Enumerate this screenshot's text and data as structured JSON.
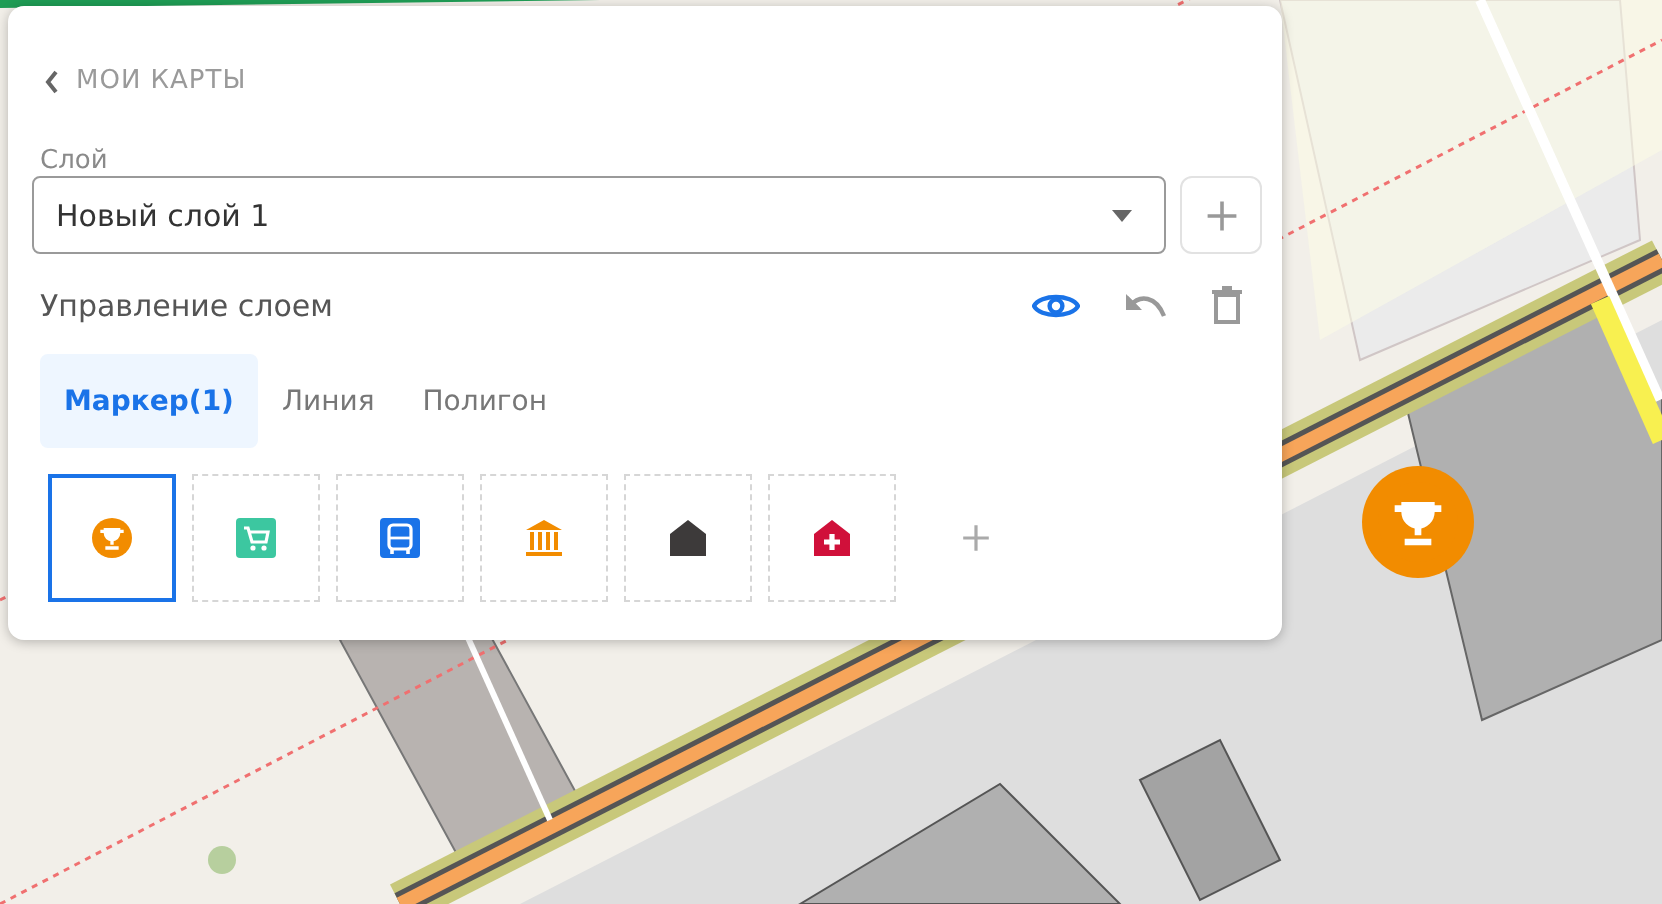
{
  "back_link": {
    "label": "МОИ КАРТЫ"
  },
  "layer_field": {
    "label": "Слой",
    "value": "Новый слой 1"
  },
  "layer_management": {
    "title": "Управление слоем"
  },
  "tabs": [
    {
      "label": "Маркер(1)",
      "selected": true
    },
    {
      "label": "Линия",
      "selected": false
    },
    {
      "label": "Полигон",
      "selected": false
    }
  ],
  "markers": [
    {
      "kind": "trophy",
      "selected": true
    },
    {
      "kind": "cart",
      "selected": false
    },
    {
      "kind": "bus",
      "selected": false
    },
    {
      "kind": "museum",
      "selected": false
    },
    {
      "kind": "home",
      "selected": false
    },
    {
      "kind": "hospital",
      "selected": false
    }
  ],
  "map_marker": {
    "kind": "trophy"
  }
}
